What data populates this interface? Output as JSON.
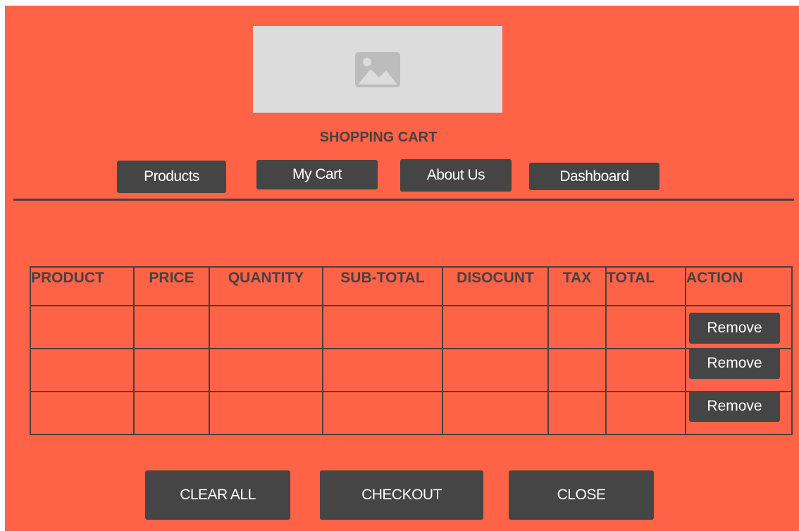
{
  "header": {
    "logo_icon": "image-placeholder-icon",
    "title": "SHOPPING CART"
  },
  "nav": {
    "items": [
      {
        "label": "Products"
      },
      {
        "label": "My Cart"
      },
      {
        "label": "About Us"
      },
      {
        "label": "Dashboard"
      }
    ]
  },
  "cart_table": {
    "columns": [
      "PRODUCT",
      "PRICE",
      "QUANTITY",
      "SUB-TOTAL",
      "DISOCUNT",
      "TAX",
      "TOTAL",
      "ACTION"
    ],
    "rows": [
      {
        "remove_label": "Remove"
      },
      {
        "remove_label": "Remove"
      },
      {
        "remove_label": "Remove"
      }
    ]
  },
  "actions": {
    "clear_all": "CLEAR ALL",
    "checkout": "CHECKOUT",
    "close": "CLOSE"
  },
  "colors": {
    "background": "#ff6347",
    "button": "#454545",
    "text_dark": "#4a4040",
    "placeholder": "#dcdcdc"
  }
}
